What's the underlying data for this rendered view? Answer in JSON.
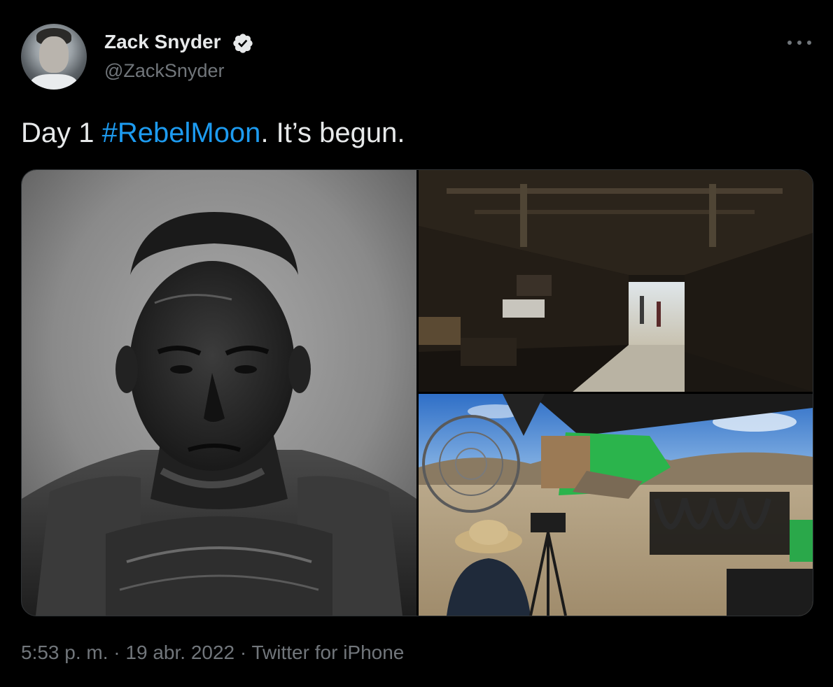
{
  "author": {
    "name": "Zack Snyder",
    "handle": "@ZackSnyder",
    "verified_icon": "verified-badge-icon"
  },
  "tweet": {
    "text_before": "Day 1 ",
    "hashtag": "#RebelMoon",
    "text_after": ". It’s begun."
  },
  "media": {
    "images": [
      "portrait-photo",
      "ship-interior-photo",
      "film-set-photo"
    ]
  },
  "meta": {
    "time": "5:53 p. m.",
    "sep1": " · ",
    "date": "19 abr. 2022",
    "sep2": " · ",
    "source": "Twitter for iPhone"
  },
  "colors": {
    "background": "#000000",
    "text": "#e7e9ea",
    "secondary": "#71767b",
    "link": "#1d9bf0"
  }
}
